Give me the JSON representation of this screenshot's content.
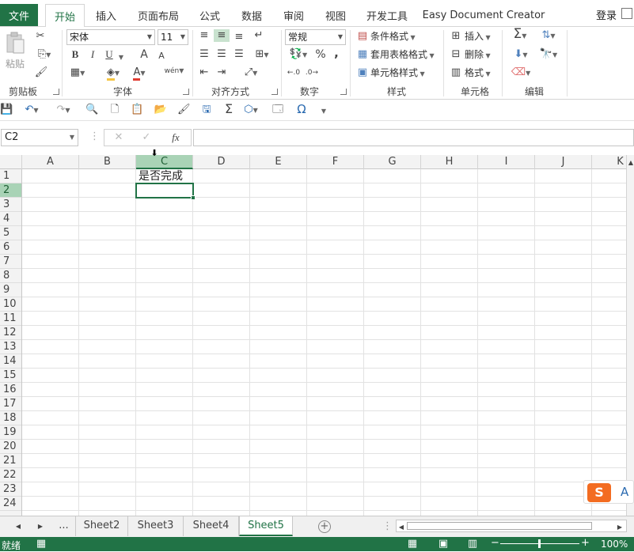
{
  "menu": {
    "file": "文件",
    "tabs": [
      {
        "label": "开始"
      },
      {
        "label": "插入"
      },
      {
        "label": "页面布局"
      },
      {
        "label": "公式"
      },
      {
        "label": "数据"
      },
      {
        "label": "审阅"
      },
      {
        "label": "视图"
      },
      {
        "label": "开发工具"
      },
      {
        "label": "Easy Document Creator"
      }
    ],
    "login": "登录"
  },
  "ribbon": {
    "clipboard": {
      "paste": "粘贴",
      "label": "剪贴板"
    },
    "font": {
      "name": "宋体",
      "size": "11",
      "bold": "B",
      "italic": "I",
      "underline": "U",
      "grow": "A",
      "shrink": "A",
      "font_color": "A",
      "phonetic": "wén",
      "label": "字体"
    },
    "alignment": {
      "label": "对齐方式"
    },
    "number": {
      "format": "常规",
      "percent": "%",
      "comma": ",",
      "label": "数字"
    },
    "styles": {
      "conditional": "条件格式",
      "table": "套用表格格式",
      "cell": "单元格样式",
      "label": "样式"
    },
    "cells": {
      "insert": "插入",
      "delete": "删除",
      "format": "格式",
      "label": "单元格"
    },
    "editing": {
      "sum": "Σ",
      "label": "编辑"
    },
    "accent": "#217346"
  },
  "formula_bar": {
    "name_box": "C2",
    "fx": "fx",
    "content": ""
  },
  "grid": {
    "columns": [
      "A",
      "B",
      "C",
      "D",
      "E",
      "F",
      "G",
      "H",
      "I",
      "J",
      "K"
    ],
    "rows": [
      "1",
      "2",
      "3",
      "4",
      "5",
      "6",
      "7",
      "8",
      "9",
      "10",
      "11",
      "12",
      "13",
      "14",
      "15",
      "16",
      "17",
      "18",
      "19",
      "20",
      "21",
      "22",
      "23",
      "24"
    ],
    "selected_column": "C",
    "selected_row": "2",
    "cells": {
      "C1": "是否完成"
    }
  },
  "sheets": {
    "more": "...",
    "tabs": [
      {
        "label": "Sheet2"
      },
      {
        "label": "Sheet3"
      },
      {
        "label": "Sheet4"
      },
      {
        "label": "Sheet5"
      }
    ],
    "active": "Sheet5"
  },
  "status": {
    "ready": "就绪",
    "zoom": "100%"
  },
  "ime": {
    "label": "A"
  }
}
